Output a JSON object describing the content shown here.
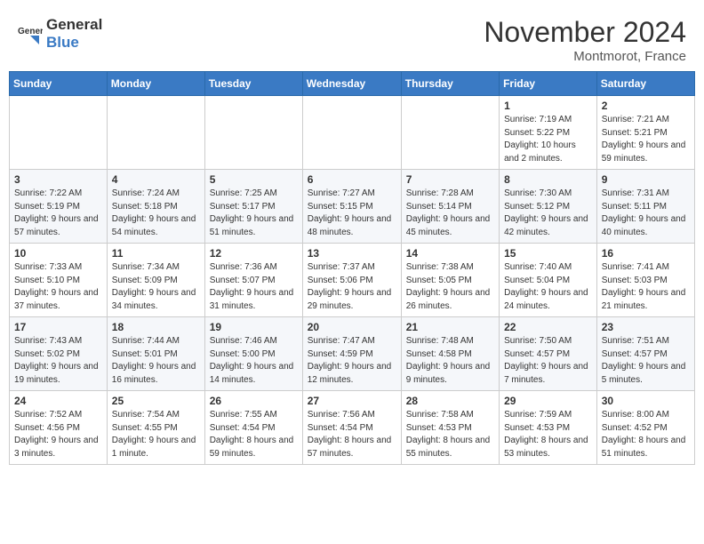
{
  "header": {
    "logo_general": "General",
    "logo_blue": "Blue",
    "month_title": "November 2024",
    "location": "Montmorot, France"
  },
  "weekdays": [
    "Sunday",
    "Monday",
    "Tuesday",
    "Wednesday",
    "Thursday",
    "Friday",
    "Saturday"
  ],
  "weeks": [
    [
      {
        "day": "",
        "sunrise": "",
        "sunset": "",
        "daylight": ""
      },
      {
        "day": "",
        "sunrise": "",
        "sunset": "",
        "daylight": ""
      },
      {
        "day": "",
        "sunrise": "",
        "sunset": "",
        "daylight": ""
      },
      {
        "day": "",
        "sunrise": "",
        "sunset": "",
        "daylight": ""
      },
      {
        "day": "",
        "sunrise": "",
        "sunset": "",
        "daylight": ""
      },
      {
        "day": "1",
        "sunrise": "Sunrise: 7:19 AM",
        "sunset": "Sunset: 5:22 PM",
        "daylight": "Daylight: 10 hours and 2 minutes."
      },
      {
        "day": "2",
        "sunrise": "Sunrise: 7:21 AM",
        "sunset": "Sunset: 5:21 PM",
        "daylight": "Daylight: 9 hours and 59 minutes."
      }
    ],
    [
      {
        "day": "3",
        "sunrise": "Sunrise: 7:22 AM",
        "sunset": "Sunset: 5:19 PM",
        "daylight": "Daylight: 9 hours and 57 minutes."
      },
      {
        "day": "4",
        "sunrise": "Sunrise: 7:24 AM",
        "sunset": "Sunset: 5:18 PM",
        "daylight": "Daylight: 9 hours and 54 minutes."
      },
      {
        "day": "5",
        "sunrise": "Sunrise: 7:25 AM",
        "sunset": "Sunset: 5:17 PM",
        "daylight": "Daylight: 9 hours and 51 minutes."
      },
      {
        "day": "6",
        "sunrise": "Sunrise: 7:27 AM",
        "sunset": "Sunset: 5:15 PM",
        "daylight": "Daylight: 9 hours and 48 minutes."
      },
      {
        "day": "7",
        "sunrise": "Sunrise: 7:28 AM",
        "sunset": "Sunset: 5:14 PM",
        "daylight": "Daylight: 9 hours and 45 minutes."
      },
      {
        "day": "8",
        "sunrise": "Sunrise: 7:30 AM",
        "sunset": "Sunset: 5:12 PM",
        "daylight": "Daylight: 9 hours and 42 minutes."
      },
      {
        "day": "9",
        "sunrise": "Sunrise: 7:31 AM",
        "sunset": "Sunset: 5:11 PM",
        "daylight": "Daylight: 9 hours and 40 minutes."
      }
    ],
    [
      {
        "day": "10",
        "sunrise": "Sunrise: 7:33 AM",
        "sunset": "Sunset: 5:10 PM",
        "daylight": "Daylight: 9 hours and 37 minutes."
      },
      {
        "day": "11",
        "sunrise": "Sunrise: 7:34 AM",
        "sunset": "Sunset: 5:09 PM",
        "daylight": "Daylight: 9 hours and 34 minutes."
      },
      {
        "day": "12",
        "sunrise": "Sunrise: 7:36 AM",
        "sunset": "Sunset: 5:07 PM",
        "daylight": "Daylight: 9 hours and 31 minutes."
      },
      {
        "day": "13",
        "sunrise": "Sunrise: 7:37 AM",
        "sunset": "Sunset: 5:06 PM",
        "daylight": "Daylight: 9 hours and 29 minutes."
      },
      {
        "day": "14",
        "sunrise": "Sunrise: 7:38 AM",
        "sunset": "Sunset: 5:05 PM",
        "daylight": "Daylight: 9 hours and 26 minutes."
      },
      {
        "day": "15",
        "sunrise": "Sunrise: 7:40 AM",
        "sunset": "Sunset: 5:04 PM",
        "daylight": "Daylight: 9 hours and 24 minutes."
      },
      {
        "day": "16",
        "sunrise": "Sunrise: 7:41 AM",
        "sunset": "Sunset: 5:03 PM",
        "daylight": "Daylight: 9 hours and 21 minutes."
      }
    ],
    [
      {
        "day": "17",
        "sunrise": "Sunrise: 7:43 AM",
        "sunset": "Sunset: 5:02 PM",
        "daylight": "Daylight: 9 hours and 19 minutes."
      },
      {
        "day": "18",
        "sunrise": "Sunrise: 7:44 AM",
        "sunset": "Sunset: 5:01 PM",
        "daylight": "Daylight: 9 hours and 16 minutes."
      },
      {
        "day": "19",
        "sunrise": "Sunrise: 7:46 AM",
        "sunset": "Sunset: 5:00 PM",
        "daylight": "Daylight: 9 hours and 14 minutes."
      },
      {
        "day": "20",
        "sunrise": "Sunrise: 7:47 AM",
        "sunset": "Sunset: 4:59 PM",
        "daylight": "Daylight: 9 hours and 12 minutes."
      },
      {
        "day": "21",
        "sunrise": "Sunrise: 7:48 AM",
        "sunset": "Sunset: 4:58 PM",
        "daylight": "Daylight: 9 hours and 9 minutes."
      },
      {
        "day": "22",
        "sunrise": "Sunrise: 7:50 AM",
        "sunset": "Sunset: 4:57 PM",
        "daylight": "Daylight: 9 hours and 7 minutes."
      },
      {
        "day": "23",
        "sunrise": "Sunrise: 7:51 AM",
        "sunset": "Sunset: 4:57 PM",
        "daylight": "Daylight: 9 hours and 5 minutes."
      }
    ],
    [
      {
        "day": "24",
        "sunrise": "Sunrise: 7:52 AM",
        "sunset": "Sunset: 4:56 PM",
        "daylight": "Daylight: 9 hours and 3 minutes."
      },
      {
        "day": "25",
        "sunrise": "Sunrise: 7:54 AM",
        "sunset": "Sunset: 4:55 PM",
        "daylight": "Daylight: 9 hours and 1 minute."
      },
      {
        "day": "26",
        "sunrise": "Sunrise: 7:55 AM",
        "sunset": "Sunset: 4:54 PM",
        "daylight": "Daylight: 8 hours and 59 minutes."
      },
      {
        "day": "27",
        "sunrise": "Sunrise: 7:56 AM",
        "sunset": "Sunset: 4:54 PM",
        "daylight": "Daylight: 8 hours and 57 minutes."
      },
      {
        "day": "28",
        "sunrise": "Sunrise: 7:58 AM",
        "sunset": "Sunset: 4:53 PM",
        "daylight": "Daylight: 8 hours and 55 minutes."
      },
      {
        "day": "29",
        "sunrise": "Sunrise: 7:59 AM",
        "sunset": "Sunset: 4:53 PM",
        "daylight": "Daylight: 8 hours and 53 minutes."
      },
      {
        "day": "30",
        "sunrise": "Sunrise: 8:00 AM",
        "sunset": "Sunset: 4:52 PM",
        "daylight": "Daylight: 8 hours and 51 minutes."
      }
    ]
  ]
}
